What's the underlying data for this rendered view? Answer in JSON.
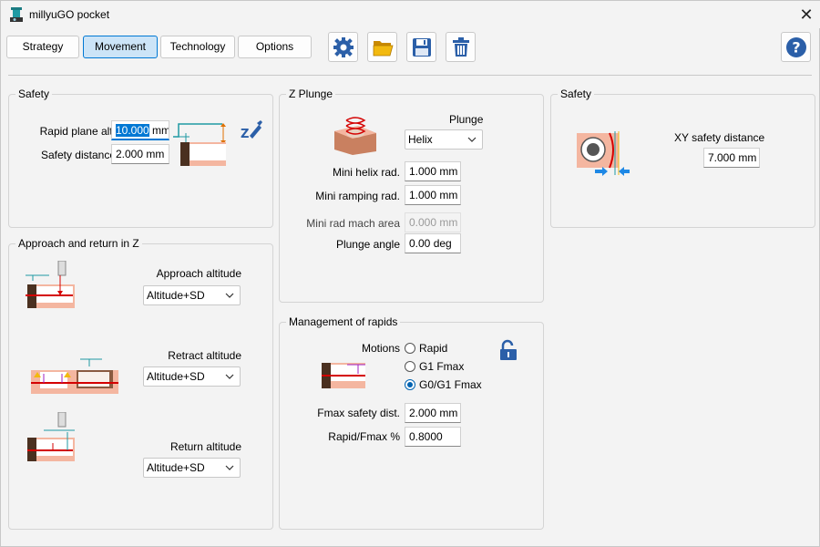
{
  "window": {
    "title": "millyuGO pocket",
    "close_glyph": "✕"
  },
  "tabs": [
    {
      "label": "Strategy"
    },
    {
      "label": "Movement",
      "active": true
    },
    {
      "label": "Technology"
    },
    {
      "label": "Options"
    }
  ],
  "toolbar": {
    "icons": [
      "gear-icon",
      "open-folder-icon",
      "save-icon",
      "delete-icon",
      "help-icon"
    ]
  },
  "safety_left": {
    "title": "Safety",
    "rapid_plane_label": "Rapid plane alt.",
    "rapid_plane_value_selected": "10.000",
    "rapid_plane_value_unit": " mm",
    "safety_distance_label": "Safety distance",
    "safety_distance_value": "2.000 mm"
  },
  "approach": {
    "title": "Approach and return in Z",
    "approach_label": "Approach altitude",
    "approach_value": "Altitude+SD",
    "retract_label": "Retract altitude",
    "retract_value": "Altitude+SD",
    "return_label": "Return altitude",
    "return_value": "Altitude+SD"
  },
  "zplunge": {
    "title": "Z Plunge",
    "plunge_label": "Plunge",
    "plunge_value": "Helix",
    "mini_helix_label": "Mini helix rad.",
    "mini_helix_value": "1.000 mm",
    "mini_ramping_label": "Mini ramping rad.",
    "mini_ramping_value": "1.000 mm",
    "mini_rad_area_label": "Mini rad mach area",
    "mini_rad_area_value": "0.000 mm",
    "plunge_angle_label": "Plunge angle",
    "plunge_angle_value": "0.00 deg"
  },
  "rapids": {
    "title": "Management of rapids",
    "motions_label": "Motions",
    "options": [
      "Rapid",
      "G1 Fmax",
      "G0/G1 Fmax"
    ],
    "selected": "G0/G1 Fmax",
    "fmax_safety_label": "Fmax safety dist.",
    "fmax_safety_value": "2.000 mm",
    "rapid_fmax_label": "Rapid/Fmax %",
    "rapid_fmax_value": "0.8000"
  },
  "safety_right": {
    "title": "Safety",
    "xy_label": "XY safety distance",
    "xy_value": "7.000 mm"
  },
  "colors": {
    "accent": "#0078d4",
    "tab_active_bg": "#cce4f7",
    "icon_blue": "#2b5fa8",
    "folder_yellow": "#f2b90f",
    "red_line": "#d40000",
    "salmon": "#f4b6a0"
  }
}
